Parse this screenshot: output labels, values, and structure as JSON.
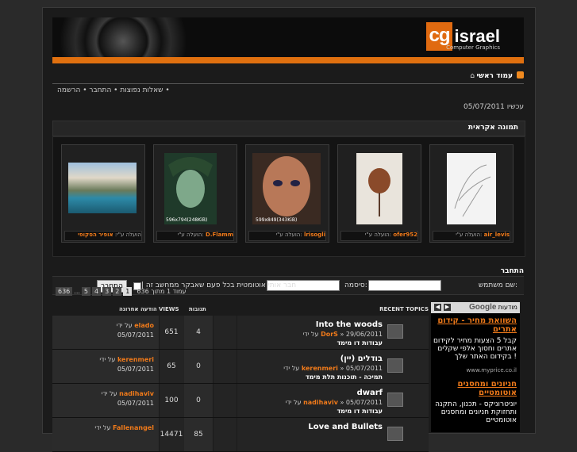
{
  "header": {
    "logo_cg": "cg",
    "logo_israel": "israel",
    "logo_sub": "Computer Graphics"
  },
  "nav": {
    "home": "עמוד ראשי",
    "links": "שאלות נפוצות • התחבר • הרשמה •",
    "date": "עכשיו 05/07/2011"
  },
  "gallery": {
    "title": "תמונה אקראית",
    "items": [
      {
        "label": "הועלה ע\"י:",
        "user": "air_levis"
      },
      {
        "label": "הועלה ע\"י:",
        "user": "ofer952"
      },
      {
        "label": "הועלה ע\"י:",
        "user": "lrisogli"
      },
      {
        "label": "הועלה ע\"י:",
        "user": "D.Flamm"
      },
      {
        "label": "הועלה ע\"י:",
        "user": "אופיר הסקופי"
      }
    ],
    "thumb_text_3": "596x794(248KiB)",
    "thumb_text_2": "599x849(343KiB)"
  },
  "login": {
    "title": "התחבר",
    "username_label": "שם משתמש:",
    "password_label": "סיסמה:",
    "remember_label": "| חבר אותי אוטומטית בכל פעם שאבקר ממחשב זה",
    "submit": "התחבר"
  },
  "pager": {
    "pages": [
      "1",
      "2",
      "3",
      "4",
      "5"
    ],
    "ellipsis": "...",
    "last": "636",
    "text": "עמוד 1 מתוך 636"
  },
  "columns": {
    "topics": "RECENT TOPICS",
    "replies": "תגובות",
    "views": "VIEWS",
    "lastpost": "הודעה אחרונה"
  },
  "topics": [
    {
      "title": "Into the woods",
      "by": "על ידי",
      "author": "DorS",
      "date": "29/06/2011",
      "forum": "עבודות דו מימד",
      "replies": "4",
      "views": "651",
      "last_by": "על ידי",
      "last_user": "elado",
      "last_date": "05/07/2011"
    },
    {
      "title": "בודלים (יין)",
      "by": "על ידי",
      "author": "kerenmeri",
      "date": "05/07/2011",
      "forum": "תמיכה - תוכנות תלת מימד",
      "replies": "0",
      "views": "65",
      "last_by": "על ידי",
      "last_user": "kerenmeri",
      "last_date": "05/07/2011"
    },
    {
      "title": "dwarf",
      "by": "על ידי",
      "author": "nadihaviv",
      "date": "05/07/2011",
      "forum": "עבודות דו מימד",
      "replies": "0",
      "views": "100",
      "last_by": "על ידי",
      "last_user": "nadihaviv",
      "last_date": "05/07/2011"
    },
    {
      "title": "Love and Bullets",
      "by": "על ידי",
      "author": "",
      "date": "",
      "forum": "",
      "replies": "85",
      "views": "14471",
      "last_by": "על ידי",
      "last_user": "Fallenangel",
      "last_date": ""
    }
  ],
  "ads": {
    "google": "Google",
    "label": "מודעות",
    "items": [
      {
        "title": "השוואת מחיר - קידום אתרים",
        "body": "קבל 5 הצעות מחיר לקידום אתרים וחסוך אלפי שקלים בקידום האתר שלך !",
        "url": "www.myprice.co.il"
      },
      {
        "title": "חניונים ומחסנים אוטומטיים",
        "body": "יוניטרוניקס - תכנון, התקנה ותחזוקת חניונים ומחסנים אוטומטיים"
      }
    ]
  }
}
